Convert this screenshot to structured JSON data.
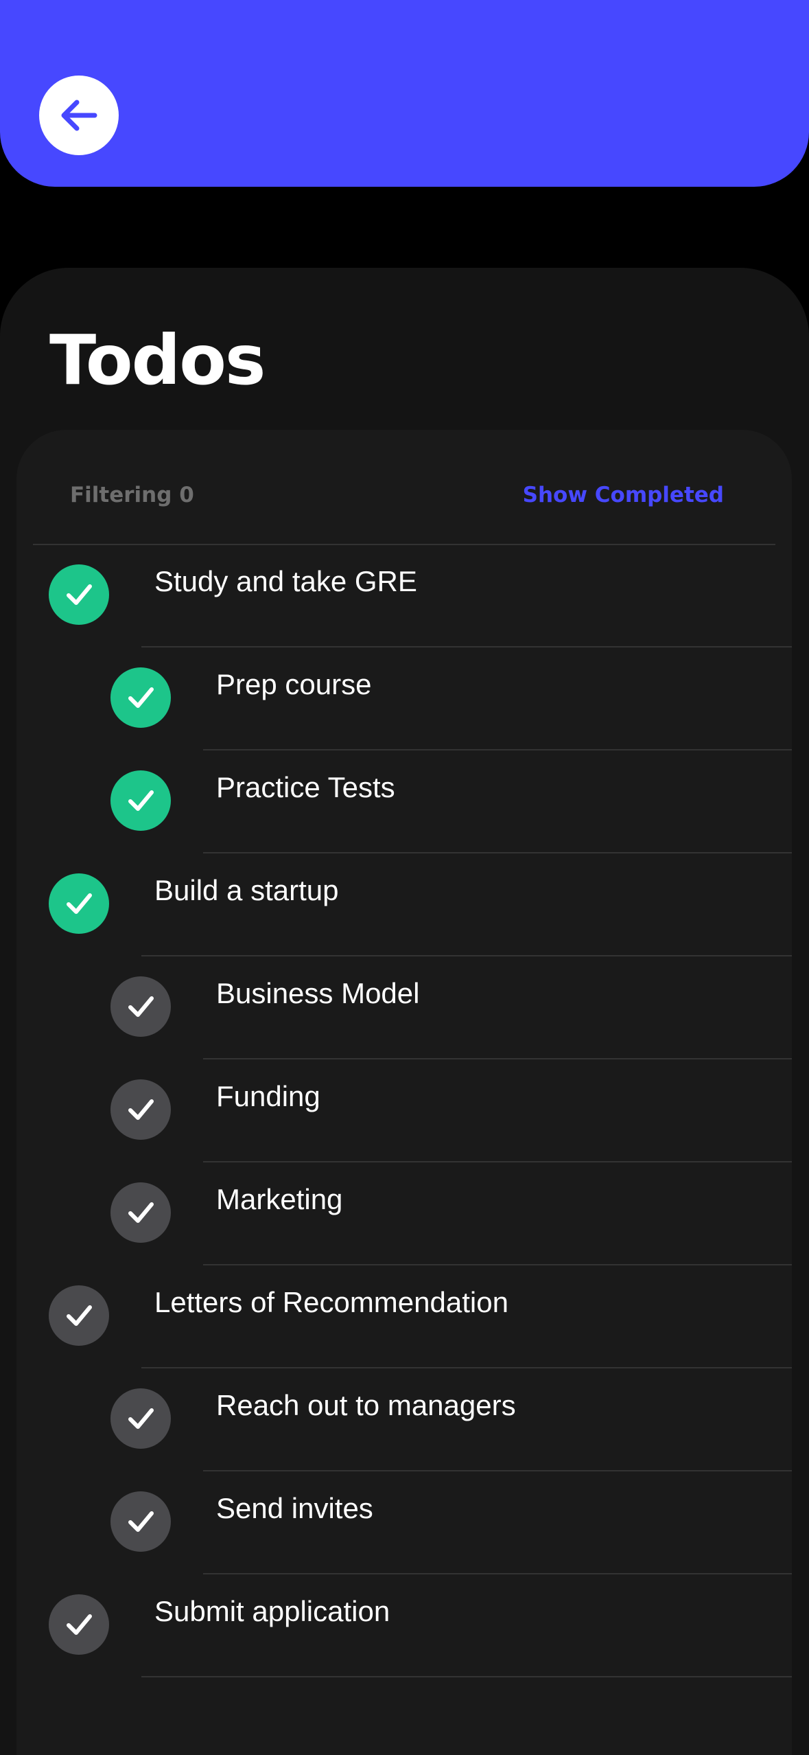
{
  "header": {
    "back_icon": "arrow-left-icon",
    "accent_color": "#4748FF"
  },
  "page": {
    "title": "Todos"
  },
  "filter": {
    "label": "Filtering 0",
    "show_completed_label": "Show Completed"
  },
  "todos": [
    {
      "label": "Study and take GRE",
      "completed": true,
      "level": 0
    },
    {
      "label": "Prep course",
      "completed": true,
      "level": 1
    },
    {
      "label": "Practice Tests",
      "completed": true,
      "level": 1
    },
    {
      "label": "Build a startup",
      "completed": true,
      "level": 0
    },
    {
      "label": "Business Model",
      "completed": false,
      "level": 1
    },
    {
      "label": "Funding",
      "completed": false,
      "level": 1
    },
    {
      "label": "Marketing",
      "completed": false,
      "level": 1
    },
    {
      "label": "Letters of Recommendation",
      "completed": false,
      "level": 0
    },
    {
      "label": "Reach out to managers",
      "completed": false,
      "level": 1
    },
    {
      "label": "Send invites",
      "completed": false,
      "level": 1
    },
    {
      "label": "Submit application",
      "completed": false,
      "level": 0
    }
  ],
  "colors": {
    "completed": "#1DC58A",
    "pending": "#4A4A4D"
  }
}
